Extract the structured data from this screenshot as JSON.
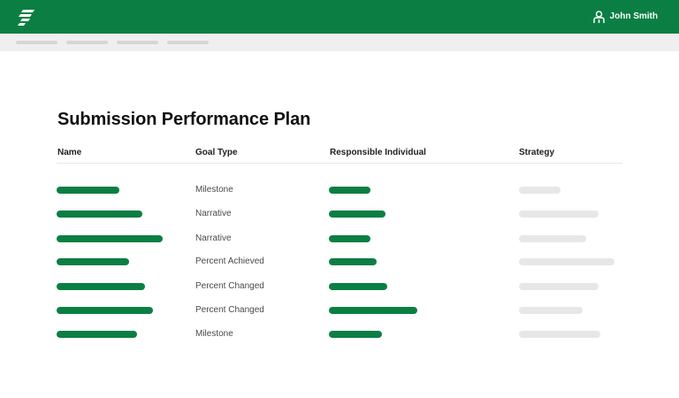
{
  "app": {
    "user_name": "John Smith",
    "brand_color": "#0b7f43",
    "logo_icon": "stacked-bars-logo-icon",
    "user_icon": "person-icon"
  },
  "page": {
    "title": "Submission Performance Plan"
  },
  "table": {
    "columns": [
      "Name",
      "Goal Type",
      "Responsible Individual",
      "Strategy"
    ],
    "rows": [
      {
        "goal_type": "Milestone"
      },
      {
        "goal_type": "Narrative"
      },
      {
        "goal_type": "Narrative"
      },
      {
        "goal_type": "Percent Achieved"
      },
      {
        "goal_type": "Percent Changed"
      },
      {
        "goal_type": "Percent Changed"
      },
      {
        "goal_type": "Milestone"
      }
    ]
  }
}
